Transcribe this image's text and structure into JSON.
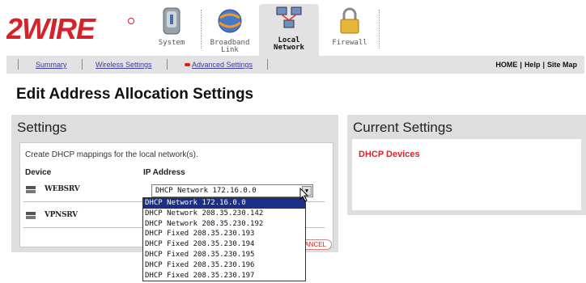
{
  "brand": {
    "logo_text": "2WIRE",
    "logo_color": "#d6222a"
  },
  "tabs": [
    {
      "label_1": "System",
      "label_2": "",
      "active": false,
      "icon": "system-icon"
    },
    {
      "label_1": "Broadband",
      "label_2": "Link",
      "active": false,
      "icon": "globe-icon"
    },
    {
      "label_1": "Local",
      "label_2": "Network",
      "active": true,
      "icon": "network-icon"
    },
    {
      "label_1": "Firewall",
      "label_2": "",
      "active": false,
      "icon": "lock-icon"
    }
  ],
  "subnav": {
    "summary": "Summary",
    "wireless": "Wireless Settings",
    "advanced": "Advanced Settings",
    "home": "HOME",
    "help": "Help",
    "sitemap": "Site Map"
  },
  "page_title": "Edit Address Allocation Settings",
  "settings": {
    "title": "Settings",
    "intro": "Create DHCP mappings for the local network(s).",
    "col_device": "Device",
    "col_ip": "IP Address",
    "devices": [
      {
        "name": "WEBSRV",
        "ip": "DHCP Network 172.16.0.0"
      },
      {
        "name": "VPNSRV",
        "ip": ""
      }
    ],
    "cancel_label": "CANCEL",
    "dropdown_options": [
      "DHCP Network 172.16.0.0",
      "DHCP Network 208.35.230.142",
      "DHCP Network 208.35.230.192",
      "DHCP Fixed 208.35.230.193",
      "DHCP Fixed 208.35.230.194",
      "DHCP Fixed 208.35.230.195",
      "DHCP Fixed 208.35.230.196",
      "DHCP Fixed 208.35.230.197"
    ],
    "dropdown_selected_index": 0
  },
  "current": {
    "title": "Current Settings",
    "dhcp_devices": "DHCP Devices"
  }
}
